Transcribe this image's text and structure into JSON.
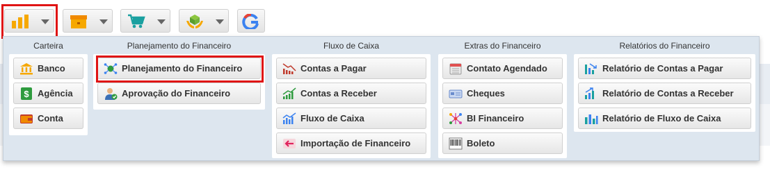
{
  "toolbar": {
    "buttons": [
      {
        "icon": "bar-chart-icon"
      },
      {
        "icon": "box-icon"
      },
      {
        "icon": "shopping-cart-icon"
      },
      {
        "icon": "hands-box-icon"
      },
      {
        "icon": "google-g-icon"
      }
    ]
  },
  "menu": {
    "carteira": {
      "title": "Carteira",
      "items": [
        "Banco",
        "Agência",
        "Conta"
      ]
    },
    "planejamento": {
      "title": "Planejamento do Financeiro",
      "items": [
        "Planejamento do Financeiro",
        "Aprovação do Financeiro"
      ]
    },
    "fluxo": {
      "title": "Fluxo de Caixa",
      "items": [
        "Contas a Pagar",
        "Contas a Receber",
        "Fluxo de Caixa",
        "Importação de Financeiro"
      ]
    },
    "extras": {
      "title": "Extras do Financeiro",
      "items": [
        "Contato Agendado",
        "Cheques",
        "BI Financeiro",
        "Boleto"
      ]
    },
    "relatorios": {
      "title": "Relatórios do Financeiro",
      "items": [
        "Relatório de Contas a Pagar",
        "Relatório de Contas a Receber",
        "Relatório de Fluxo de Caixa"
      ]
    }
  },
  "colors": {
    "highlight": "#e01414",
    "panel_bg": "#dde6ef"
  }
}
